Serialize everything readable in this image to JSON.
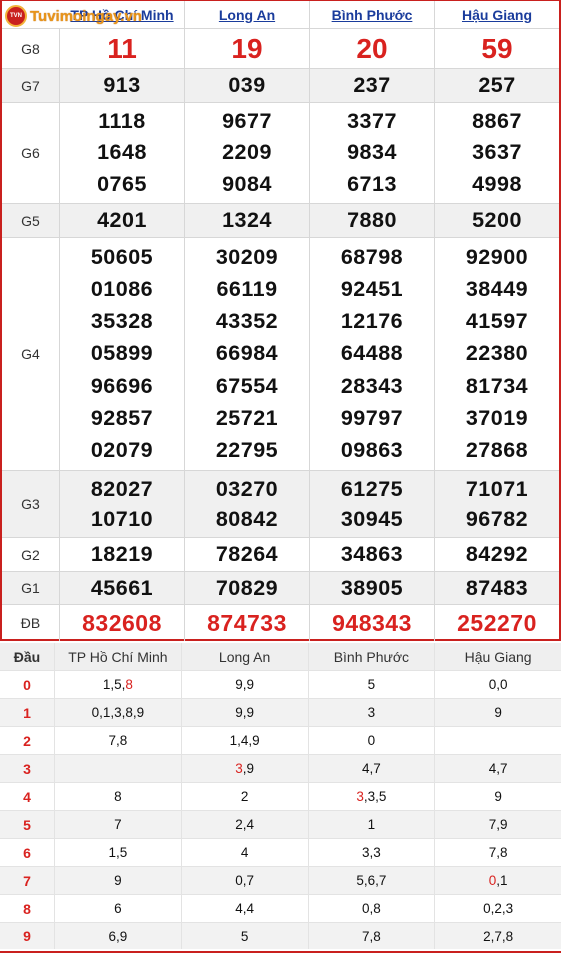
{
  "site": {
    "logo_text": "Tuvimoingay.vn",
    "badge_text": "TVN"
  },
  "provinces": [
    "TP Hồ Chí Minh",
    "Long An",
    "Bình Phước",
    "Hậu Giang"
  ],
  "prizes": {
    "g8": {
      "label": "G8",
      "values": [
        "11",
        "19",
        "20",
        "59"
      ]
    },
    "g7": {
      "label": "G7",
      "values": [
        "913",
        "039",
        "237",
        "257"
      ]
    },
    "g6": {
      "label": "G6",
      "values": [
        [
          "1118",
          "1648",
          "0765"
        ],
        [
          "9677",
          "2209",
          "9084"
        ],
        [
          "3377",
          "9834",
          "6713"
        ],
        [
          "8867",
          "3637",
          "4998"
        ]
      ]
    },
    "g5": {
      "label": "G5",
      "values": [
        "4201",
        "1324",
        "7880",
        "5200"
      ]
    },
    "g4": {
      "label": "G4",
      "values": [
        [
          "50605",
          "01086",
          "35328",
          "05899",
          "96696",
          "92857",
          "02079"
        ],
        [
          "30209",
          "66119",
          "43352",
          "66984",
          "67554",
          "25721",
          "22795"
        ],
        [
          "68798",
          "92451",
          "12176",
          "64488",
          "28343",
          "99797",
          "09863"
        ],
        [
          "92900",
          "38449",
          "41597",
          "22380",
          "81734",
          "37019",
          "27868"
        ]
      ]
    },
    "g3": {
      "label": "G3",
      "values": [
        [
          "82027",
          "10710"
        ],
        [
          "03270",
          "80842"
        ],
        [
          "61275",
          "30945"
        ],
        [
          "71071",
          "96782"
        ]
      ]
    },
    "g2": {
      "label": "G2",
      "values": [
        "18219",
        "78264",
        "34863",
        "84292"
      ]
    },
    "g1": {
      "label": "G1",
      "values": [
        "45661",
        "70829",
        "38905",
        "87483"
      ]
    },
    "db": {
      "label": "ĐB",
      "values": [
        "832608",
        "874733",
        "948343",
        "252270"
      ]
    }
  },
  "dau": {
    "header": "Đầu",
    "columns": [
      "TP Hồ Chí Minh",
      "Long An",
      "Bình Phước",
      "Hậu Giang"
    ],
    "rows": [
      {
        "head": "0",
        "cells": [
          [
            "1,5,",
            "8"
          ],
          [
            "9,9",
            ""
          ],
          [
            "5",
            ""
          ],
          [
            "0,0",
            ""
          ]
        ]
      },
      {
        "head": "1",
        "cells": [
          [
            "0,1,3,8,9",
            ""
          ],
          [
            "9,9",
            ""
          ],
          [
            "3",
            ""
          ],
          [
            "9",
            ""
          ]
        ]
      },
      {
        "head": "2",
        "cells": [
          [
            "7,8",
            ""
          ],
          [
            "1,4,9",
            ""
          ],
          [
            "0",
            ""
          ],
          [
            "",
            ""
          ]
        ]
      },
      {
        "head": "3",
        "cells": [
          [
            "",
            ""
          ],
          [
            "",
            "3",
            ",9"
          ],
          [
            "4,7",
            ""
          ],
          [
            "4,7",
            ""
          ]
        ]
      },
      {
        "head": "4",
        "cells": [
          [
            "8",
            ""
          ],
          [
            "2",
            ""
          ],
          [
            "",
            "3",
            ",3,5"
          ],
          [
            "9",
            ""
          ]
        ]
      },
      {
        "head": "5",
        "cells": [
          [
            "7",
            ""
          ],
          [
            "2,4",
            ""
          ],
          [
            "1",
            ""
          ],
          [
            "7,9",
            ""
          ]
        ]
      },
      {
        "head": "6",
        "cells": [
          [
            "1,5",
            ""
          ],
          [
            "4",
            ""
          ],
          [
            "3,3",
            ""
          ],
          [
            "7,8",
            ""
          ]
        ]
      },
      {
        "head": "7",
        "cells": [
          [
            "9",
            ""
          ],
          [
            "0,7",
            ""
          ],
          [
            "5,6,7",
            ""
          ],
          [
            "",
            "0",
            ",1"
          ]
        ]
      },
      {
        "head": "8",
        "cells": [
          [
            "6",
            ""
          ],
          [
            "4,4",
            ""
          ],
          [
            "0,8",
            ""
          ],
          [
            "0,2,3",
            ""
          ]
        ]
      },
      {
        "head": "9",
        "cells": [
          [
            "6,9",
            ""
          ],
          [
            "5",
            ""
          ],
          [
            "7,8",
            ""
          ],
          [
            "2,7,8",
            ""
          ]
        ]
      }
    ]
  },
  "colors": {
    "accent_red": "#d9221f",
    "border_red": "#c9201e",
    "link_blue": "#1a3c9c",
    "logo_orange": "#e8941a"
  }
}
